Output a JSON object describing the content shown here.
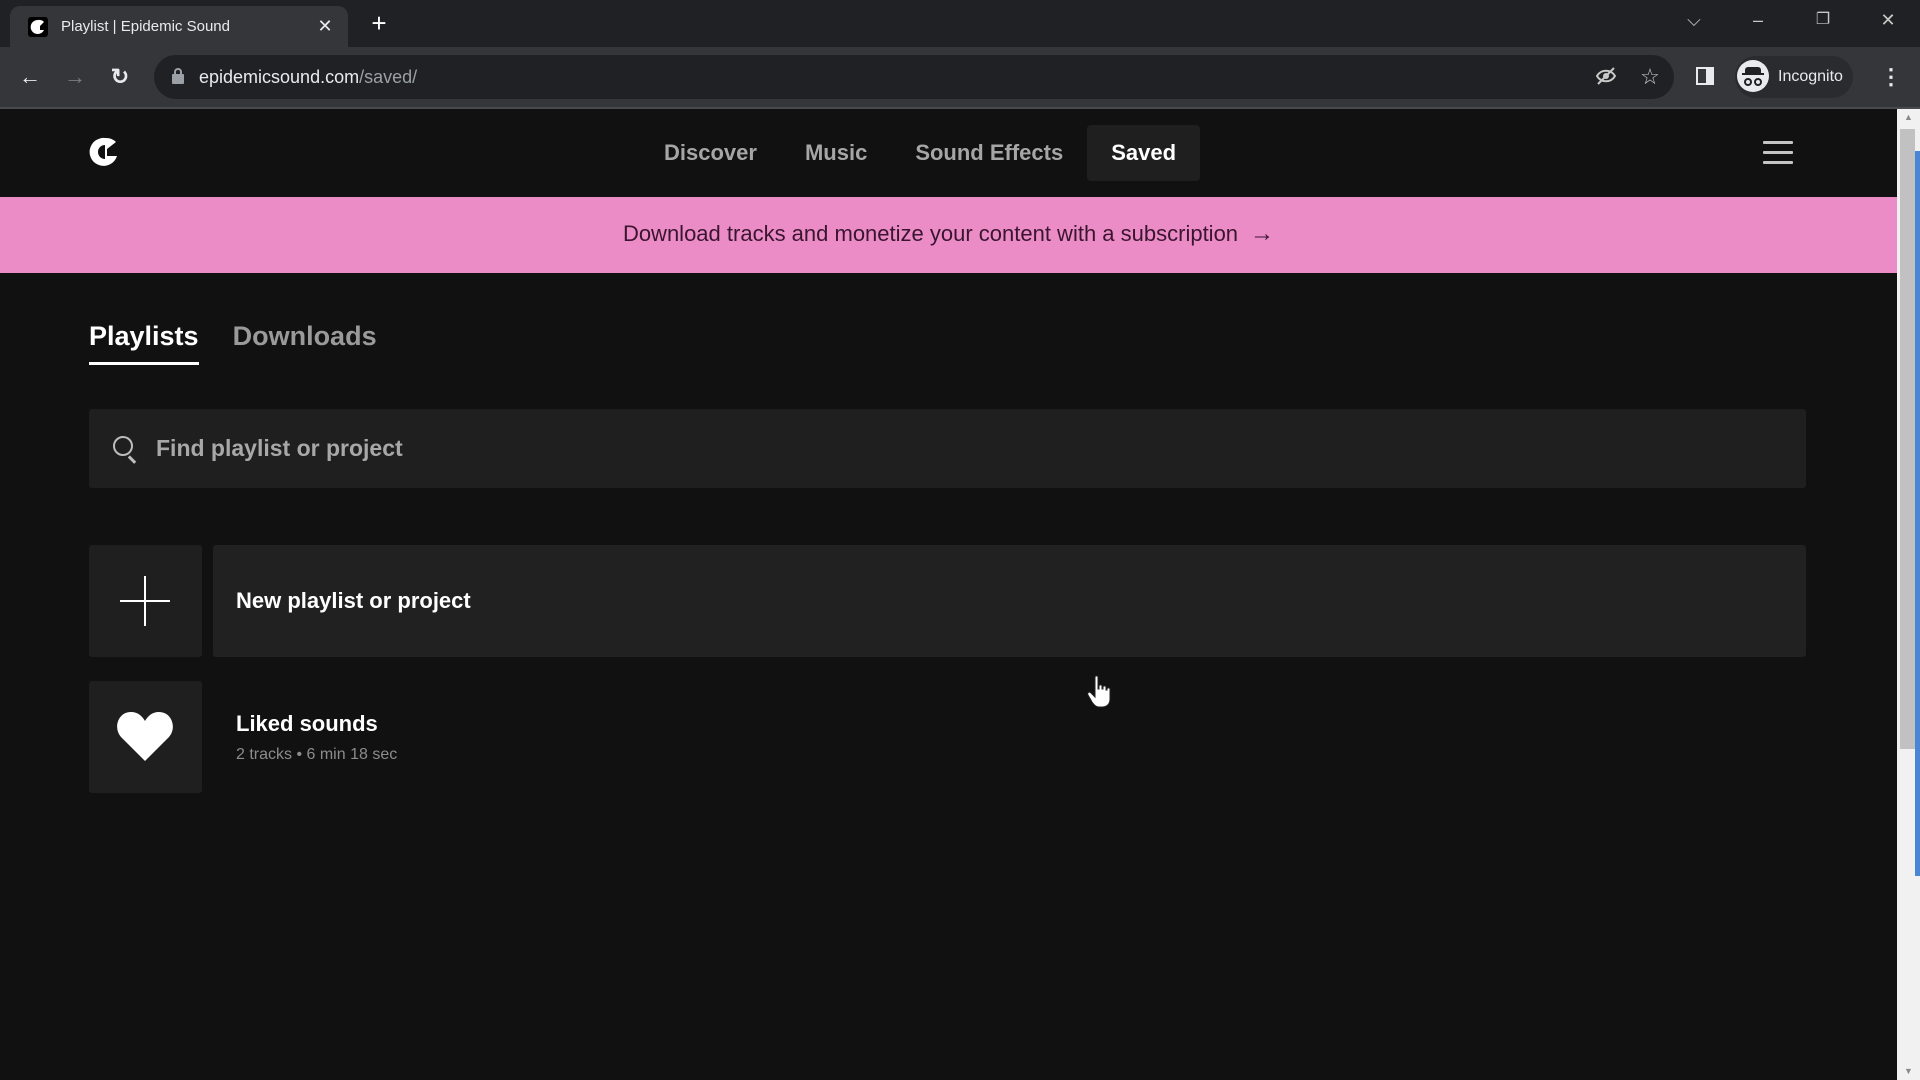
{
  "browser": {
    "tab": {
      "title": "Playlist | Epidemic Sound",
      "favicon": "epidemic-logo"
    },
    "new_tab_label": "+",
    "window_controls": {
      "tab_search": "⌵",
      "minimize": "–",
      "restore": "❐",
      "close": "✕"
    },
    "nav": {
      "back": "←",
      "forward": "→",
      "reload": "↻"
    },
    "url": {
      "host": "epidemicsound.com",
      "path": "/saved/"
    },
    "omnibox_icons": {
      "tracking_protection": "eye-off",
      "bookmark": "☆"
    },
    "profile": {
      "label": "Incognito"
    },
    "menu_glyph": "⋮"
  },
  "site": {
    "nav": {
      "links": [
        {
          "label": "Discover",
          "active": false
        },
        {
          "label": "Music",
          "active": false
        },
        {
          "label": "Sound Effects",
          "active": false
        },
        {
          "label": "Saved",
          "active": true
        }
      ]
    },
    "banner": {
      "text": "Download tracks and monetize your content with a subscription",
      "arrow": "→",
      "color": "#ec8cc6"
    },
    "tabs": [
      {
        "label": "Playlists",
        "active": true
      },
      {
        "label": "Downloads",
        "active": false
      }
    ],
    "search": {
      "placeholder": "Find playlist or project",
      "value": ""
    },
    "list": {
      "new_item": {
        "title": "New playlist or project"
      },
      "liked": {
        "title": "Liked sounds",
        "subtitle": "2 tracks • 6 min 18 sec"
      }
    }
  },
  "scrollbar": {
    "up": "▲",
    "down": "▼"
  }
}
